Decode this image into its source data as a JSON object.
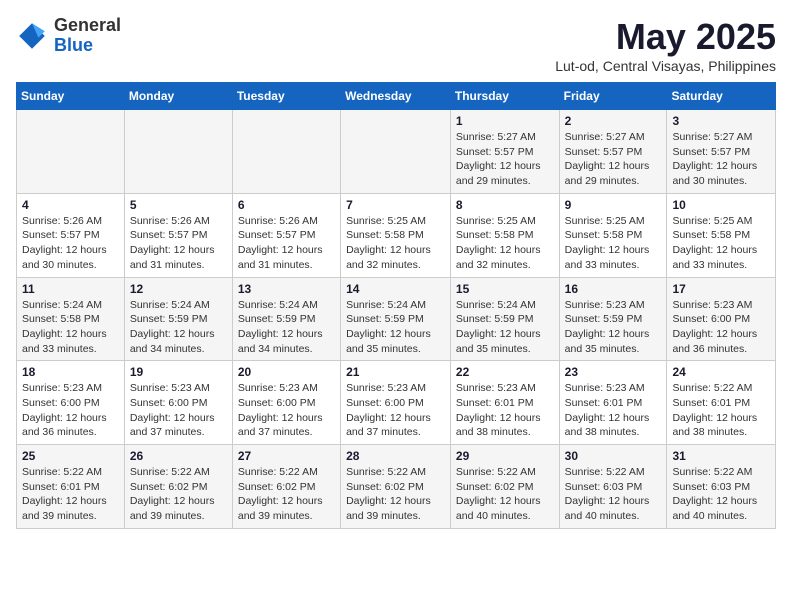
{
  "logo": {
    "general": "General",
    "blue": "Blue"
  },
  "title": "May 2025",
  "subtitle": "Lut-od, Central Visayas, Philippines",
  "days_of_week": [
    "Sunday",
    "Monday",
    "Tuesday",
    "Wednesday",
    "Thursday",
    "Friday",
    "Saturday"
  ],
  "weeks": [
    [
      {
        "num": "",
        "info": ""
      },
      {
        "num": "",
        "info": ""
      },
      {
        "num": "",
        "info": ""
      },
      {
        "num": "",
        "info": ""
      },
      {
        "num": "1",
        "info": "Sunrise: 5:27 AM\nSunset: 5:57 PM\nDaylight: 12 hours\nand 29 minutes."
      },
      {
        "num": "2",
        "info": "Sunrise: 5:27 AM\nSunset: 5:57 PM\nDaylight: 12 hours\nand 29 minutes."
      },
      {
        "num": "3",
        "info": "Sunrise: 5:27 AM\nSunset: 5:57 PM\nDaylight: 12 hours\nand 30 minutes."
      }
    ],
    [
      {
        "num": "4",
        "info": "Sunrise: 5:26 AM\nSunset: 5:57 PM\nDaylight: 12 hours\nand 30 minutes."
      },
      {
        "num": "5",
        "info": "Sunrise: 5:26 AM\nSunset: 5:57 PM\nDaylight: 12 hours\nand 31 minutes."
      },
      {
        "num": "6",
        "info": "Sunrise: 5:26 AM\nSunset: 5:57 PM\nDaylight: 12 hours\nand 31 minutes."
      },
      {
        "num": "7",
        "info": "Sunrise: 5:25 AM\nSunset: 5:58 PM\nDaylight: 12 hours\nand 32 minutes."
      },
      {
        "num": "8",
        "info": "Sunrise: 5:25 AM\nSunset: 5:58 PM\nDaylight: 12 hours\nand 32 minutes."
      },
      {
        "num": "9",
        "info": "Sunrise: 5:25 AM\nSunset: 5:58 PM\nDaylight: 12 hours\nand 33 minutes."
      },
      {
        "num": "10",
        "info": "Sunrise: 5:25 AM\nSunset: 5:58 PM\nDaylight: 12 hours\nand 33 minutes."
      }
    ],
    [
      {
        "num": "11",
        "info": "Sunrise: 5:24 AM\nSunset: 5:58 PM\nDaylight: 12 hours\nand 33 minutes."
      },
      {
        "num": "12",
        "info": "Sunrise: 5:24 AM\nSunset: 5:59 PM\nDaylight: 12 hours\nand 34 minutes."
      },
      {
        "num": "13",
        "info": "Sunrise: 5:24 AM\nSunset: 5:59 PM\nDaylight: 12 hours\nand 34 minutes."
      },
      {
        "num": "14",
        "info": "Sunrise: 5:24 AM\nSunset: 5:59 PM\nDaylight: 12 hours\nand 35 minutes."
      },
      {
        "num": "15",
        "info": "Sunrise: 5:24 AM\nSunset: 5:59 PM\nDaylight: 12 hours\nand 35 minutes."
      },
      {
        "num": "16",
        "info": "Sunrise: 5:23 AM\nSunset: 5:59 PM\nDaylight: 12 hours\nand 35 minutes."
      },
      {
        "num": "17",
        "info": "Sunrise: 5:23 AM\nSunset: 6:00 PM\nDaylight: 12 hours\nand 36 minutes."
      }
    ],
    [
      {
        "num": "18",
        "info": "Sunrise: 5:23 AM\nSunset: 6:00 PM\nDaylight: 12 hours\nand 36 minutes."
      },
      {
        "num": "19",
        "info": "Sunrise: 5:23 AM\nSunset: 6:00 PM\nDaylight: 12 hours\nand 37 minutes."
      },
      {
        "num": "20",
        "info": "Sunrise: 5:23 AM\nSunset: 6:00 PM\nDaylight: 12 hours\nand 37 minutes."
      },
      {
        "num": "21",
        "info": "Sunrise: 5:23 AM\nSunset: 6:00 PM\nDaylight: 12 hours\nand 37 minutes."
      },
      {
        "num": "22",
        "info": "Sunrise: 5:23 AM\nSunset: 6:01 PM\nDaylight: 12 hours\nand 38 minutes."
      },
      {
        "num": "23",
        "info": "Sunrise: 5:23 AM\nSunset: 6:01 PM\nDaylight: 12 hours\nand 38 minutes."
      },
      {
        "num": "24",
        "info": "Sunrise: 5:22 AM\nSunset: 6:01 PM\nDaylight: 12 hours\nand 38 minutes."
      }
    ],
    [
      {
        "num": "25",
        "info": "Sunrise: 5:22 AM\nSunset: 6:01 PM\nDaylight: 12 hours\nand 39 minutes."
      },
      {
        "num": "26",
        "info": "Sunrise: 5:22 AM\nSunset: 6:02 PM\nDaylight: 12 hours\nand 39 minutes."
      },
      {
        "num": "27",
        "info": "Sunrise: 5:22 AM\nSunset: 6:02 PM\nDaylight: 12 hours\nand 39 minutes."
      },
      {
        "num": "28",
        "info": "Sunrise: 5:22 AM\nSunset: 6:02 PM\nDaylight: 12 hours\nand 39 minutes."
      },
      {
        "num": "29",
        "info": "Sunrise: 5:22 AM\nSunset: 6:02 PM\nDaylight: 12 hours\nand 40 minutes."
      },
      {
        "num": "30",
        "info": "Sunrise: 5:22 AM\nSunset: 6:03 PM\nDaylight: 12 hours\nand 40 minutes."
      },
      {
        "num": "31",
        "info": "Sunrise: 5:22 AM\nSunset: 6:03 PM\nDaylight: 12 hours\nand 40 minutes."
      }
    ]
  ]
}
